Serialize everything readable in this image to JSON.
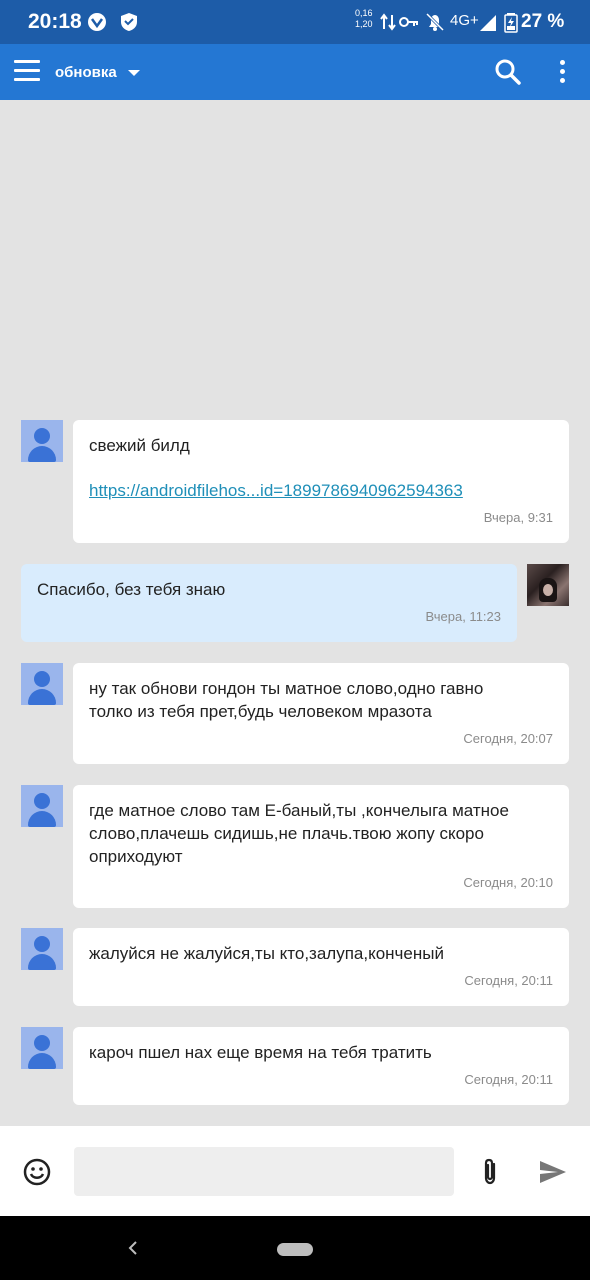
{
  "status_bar": {
    "time": "20:18",
    "speed_up": "0,16",
    "speed_down": "1,20",
    "network": "4G+",
    "battery": "27 %"
  },
  "app_bar": {
    "title": "обновка",
    "menu_icon": "hamburger-menu-icon",
    "search_icon": "search-icon",
    "more_icon": "more-vert-icon"
  },
  "messages": [
    {
      "sender": "other",
      "text": "свежий билд",
      "link": "https://androidfilehos...id=1899786940962594363",
      "time": "Вчера, 9:31"
    },
    {
      "sender": "self",
      "text": "Спасибо, без тебя знаю",
      "time": "Вчера, 11:23"
    },
    {
      "sender": "other",
      "text": "ну так обнови гондон ты матное слово,одно гавно\nтолко из тебя прет,будь человеком мразота",
      "time": "Сегодня, 20:07"
    },
    {
      "sender": "other",
      "text": "где матное слово там Е-баный,ты ,кончелыга матное\nслово,плачешь сидишь,не плачь.твою жопу скоро\nоприходуют",
      "time": "Сегодня, 20:10"
    },
    {
      "sender": "other",
      "text": "жалуйся не жалуйся,ты кто,залупа,конченый",
      "time": "Сегодня, 20:11"
    },
    {
      "sender": "other",
      "text": "кароч пшел нах еще время на тебя тратить",
      "time": "Сегодня, 20:11"
    }
  ],
  "input_bar": {
    "placeholder": "",
    "emoji_icon": "emoji-icon",
    "attach_icon": "paperclip-icon",
    "send_icon": "send-icon"
  },
  "colors": {
    "status_bar": "#1d5ca8",
    "app_bar": "#2477d3",
    "chat_bg": "#e3e3e3",
    "self_bubble": "#d9ecfd",
    "link": "#1f8fb8"
  }
}
